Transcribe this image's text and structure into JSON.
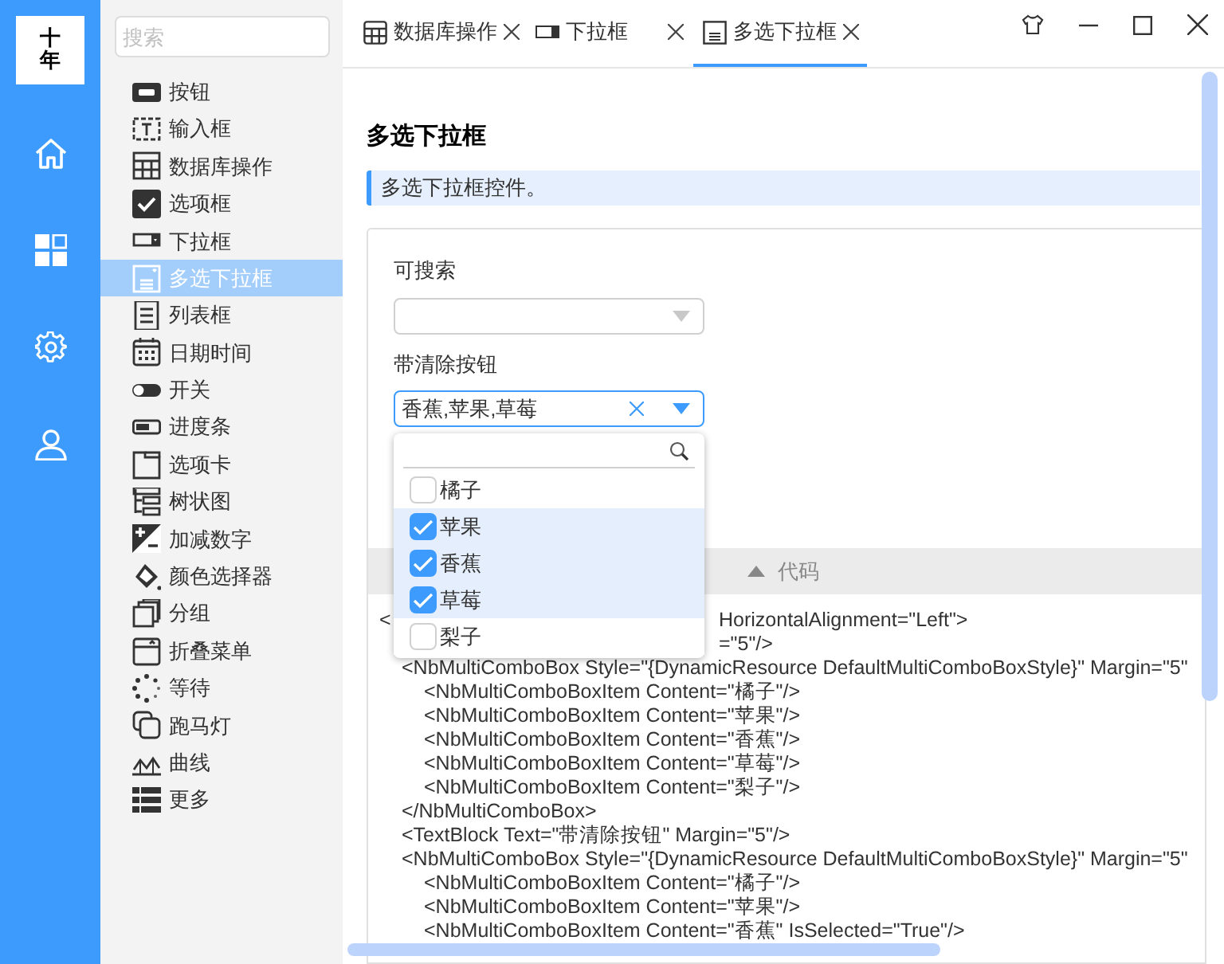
{
  "logo": {
    "text": "十年"
  },
  "rail": {
    "items": [
      {
        "selected": false
      },
      {
        "selected": false
      },
      {
        "selected": false
      },
      {
        "selected": false
      }
    ]
  },
  "sidebar": {
    "search": {
      "placeholder": "搜索"
    },
    "items": [
      {
        "label": "按钮",
        "selected": false
      },
      {
        "label": "输入框",
        "selected": false
      },
      {
        "label": "数据库操作",
        "selected": false
      },
      {
        "label": "选项框",
        "selected": false
      },
      {
        "label": "下拉框",
        "selected": false
      },
      {
        "label": "多选下拉框",
        "selected": true
      },
      {
        "label": "列表框",
        "selected": false
      },
      {
        "label": "日期时间",
        "selected": false
      },
      {
        "label": "开关",
        "selected": false
      },
      {
        "label": "进度条",
        "selected": false
      },
      {
        "label": "选项卡",
        "selected": false
      },
      {
        "label": "树状图",
        "selected": false
      },
      {
        "label": "加减数字",
        "selected": false
      },
      {
        "label": "颜色选择器",
        "selected": false
      },
      {
        "label": "分组",
        "selected": false
      },
      {
        "label": "折叠菜单",
        "selected": false
      },
      {
        "label": "等待",
        "selected": false
      },
      {
        "label": "跑马灯",
        "selected": false
      },
      {
        "label": "曲线",
        "selected": false
      },
      {
        "label": "更多",
        "selected": false
      }
    ]
  },
  "tabs": [
    {
      "label": "数据库操作",
      "selected": false
    },
    {
      "label": "下拉框",
      "selected": false
    },
    {
      "label": "多选下拉框",
      "selected": true
    }
  ],
  "page": {
    "title": "多选下拉框",
    "description": "多选下拉框控件。",
    "searchable": {
      "label": "可搜索"
    },
    "clearable": {
      "label": "带清除按钮",
      "value": "香蕉,苹果,草莓",
      "expanded": true
    },
    "dropdown": {
      "items": [
        {
          "label": "橘子",
          "checked": false
        },
        {
          "label": "苹果",
          "checked": true
        },
        {
          "label": "香蕉",
          "checked": true
        },
        {
          "label": "草莓",
          "checked": true
        },
        {
          "label": "梨子",
          "checked": false
        }
      ]
    },
    "code_header": {
      "label": "代码",
      "expanded": true
    },
    "code": [
      {
        "text": "<",
        "tail": "HorizontalAlignment=\"Left\">",
        "children": [
          {
            "tail": "=\"5\"/>"
          },
          {
            "text": "<NbMultiComboBox Style=\"{DynamicResource DefaultMultiComboBoxStyle}\" Margin=\"5\"",
            "children": [
              {
                "text": "<NbMultiComboBoxItem Content=\"橘子\"/>"
              },
              {
                "text": "<NbMultiComboBoxItem Content=\"苹果\"/>"
              },
              {
                "text": "<NbMultiComboBoxItem Content=\"香蕉\"/>"
              },
              {
                "text": "<NbMultiComboBoxItem Content=\"草莓\"/>"
              },
              {
                "text": "<NbMultiComboBoxItem Content=\"梨子\"/>"
              }
            ]
          },
          {
            "text": "</NbMultiComboBox>"
          },
          {
            "text": "<TextBlock Text=\"带清除按钮\" Margin=\"5\"/>"
          },
          {
            "text": "<NbMultiComboBox Style=\"{DynamicResource DefaultMultiComboBoxStyle}\" Margin=\"5\"",
            "children": [
              {
                "text": "<NbMultiComboBoxItem Content=\"橘子\"/>"
              },
              {
                "text": "<NbMultiComboBoxItem Content=\"苹果\"/>"
              },
              {
                "text": "<NbMultiComboBoxItem Content=\"香蕉\" IsSelected=\"True\"/>"
              }
            ]
          }
        ]
      }
    ]
  }
}
